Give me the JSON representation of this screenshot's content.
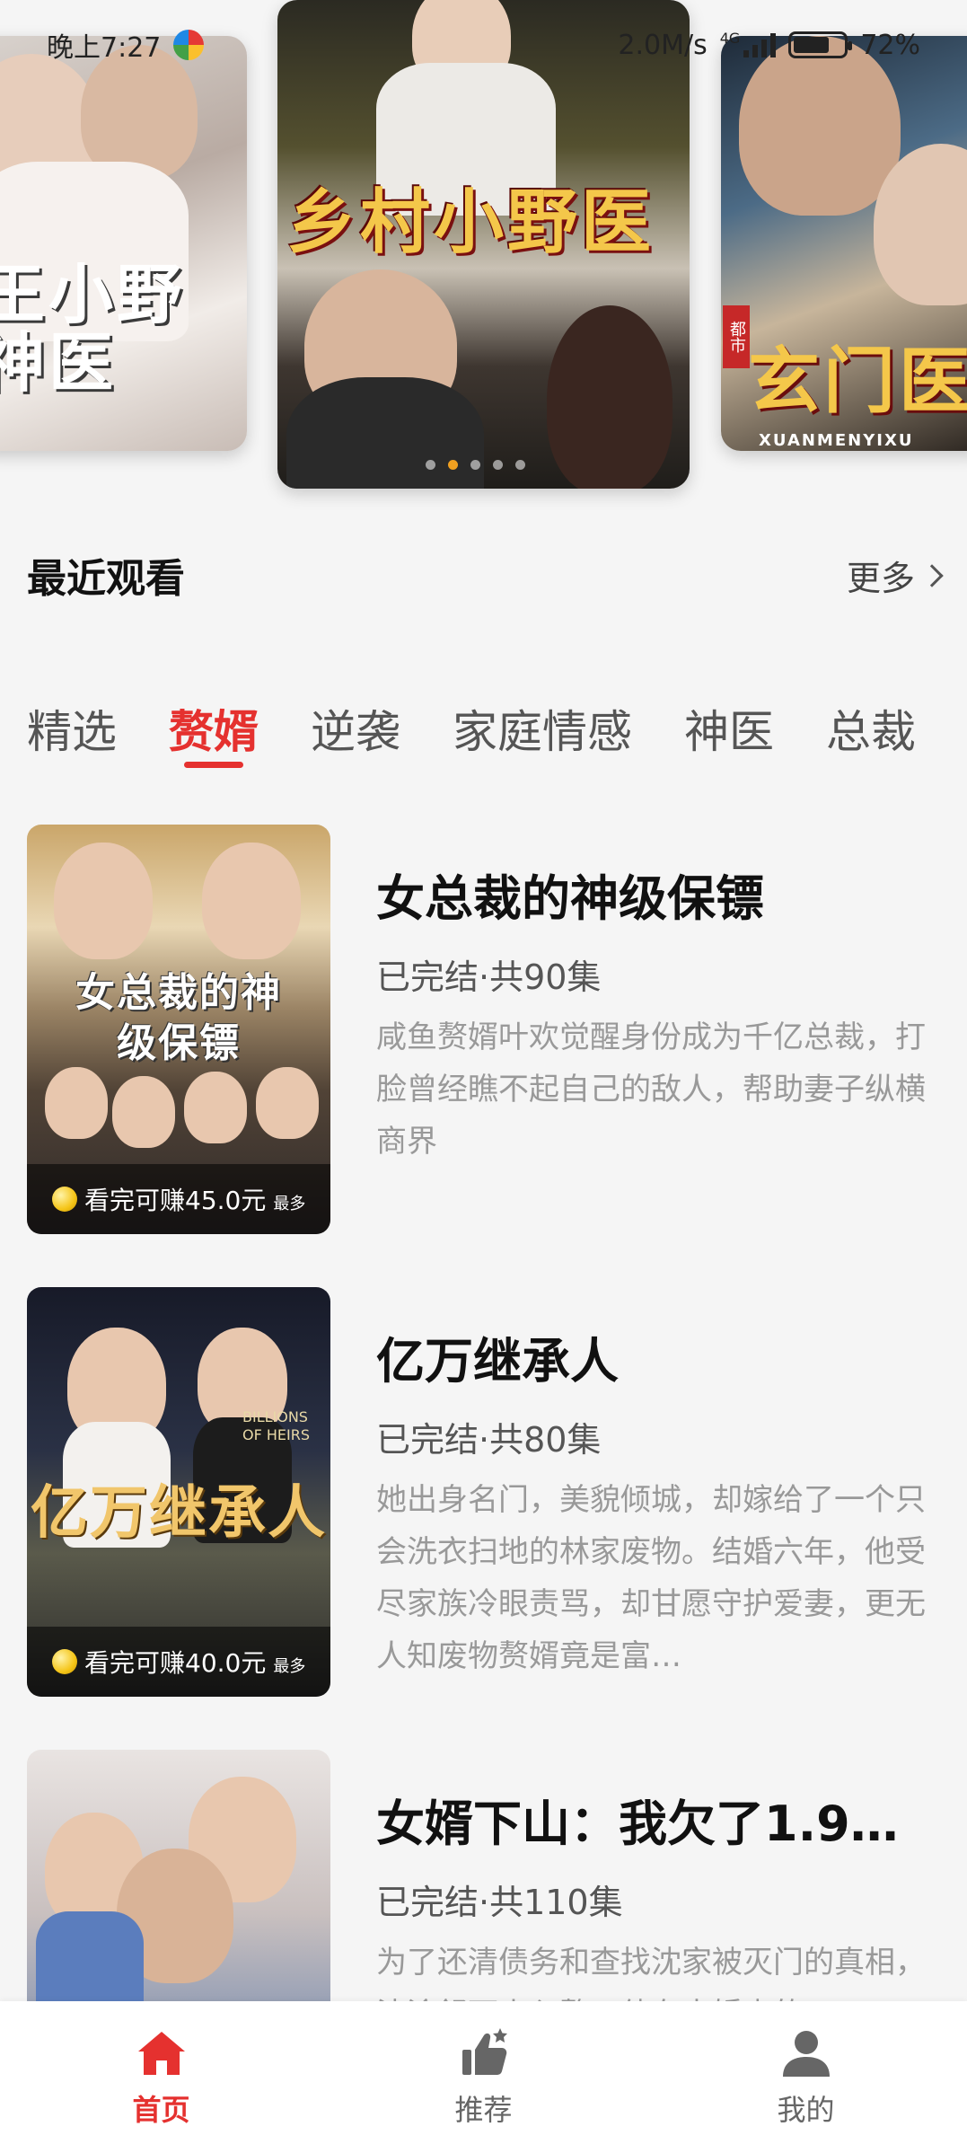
{
  "status_bar": {
    "time": "晚上7:27",
    "net_speed": "2.0M/s",
    "network": "4G",
    "battery": "72%"
  },
  "banner": {
    "left_title": "王小野神医",
    "center_title": "乡村小野医",
    "right_title": "玄门医",
    "right_tag": "都市",
    "right_subtitle": "XUANMENYIXU",
    "dots": 5,
    "active_dot": 1
  },
  "recent": {
    "title": "最近观看",
    "more": "更多"
  },
  "tabs": [
    {
      "label": "精选",
      "active": false
    },
    {
      "label": "赘婿",
      "active": true
    },
    {
      "label": "逆袭",
      "active": false
    },
    {
      "label": "家庭情感",
      "active": false
    },
    {
      "label": "神医",
      "active": false
    },
    {
      "label": "总裁",
      "active": false
    }
  ],
  "dramas": [
    {
      "title": "女总裁的神级保镖",
      "meta": "已完结·共90集",
      "desc": "咸鱼赘婿叶欢觉醒身份成为千亿总裁，打脸曾经瞧不起自己的敌人，帮助妻子纵横商界",
      "cover_text": "女总裁的神级保镖",
      "earn": "看完可赚45.0元",
      "earn_suffix": "最多"
    },
    {
      "title": "亿万继承人",
      "meta": "已完结·共80集",
      "desc": "她出身名门，美貌倾城，却嫁给了一个只会洗衣扫地的林家废物。结婚六年，他受尽家族冷眼责骂，却甘愿守护爱妻，更无人知废物赘婿竟是富…",
      "cover_text": "亿万继承人",
      "cover_en": "BILLIONS OF HEIRS",
      "earn": "看完可赚40.0元",
      "earn_suffix": "最多"
    },
    {
      "title": "女婿下山：我欠了1.9…",
      "meta": "已完结·共110集",
      "desc": "为了还清债务和查找沈家被灭门的真相，沈渝舒下山入赘，他在未婚妻的…",
      "cover_text": "",
      "earn": "",
      "earn_suffix": ""
    }
  ],
  "bottom_nav": [
    {
      "label": "首页",
      "icon": "home-icon",
      "active": true
    },
    {
      "label": "推荐",
      "icon": "thumbs-up-icon",
      "active": false
    },
    {
      "label": "我的",
      "icon": "user-icon",
      "active": false
    }
  ],
  "colors": {
    "accent": "#e5312f",
    "background": "#f5f5f5",
    "text_primary": "#111111",
    "text_secondary": "#999999"
  }
}
